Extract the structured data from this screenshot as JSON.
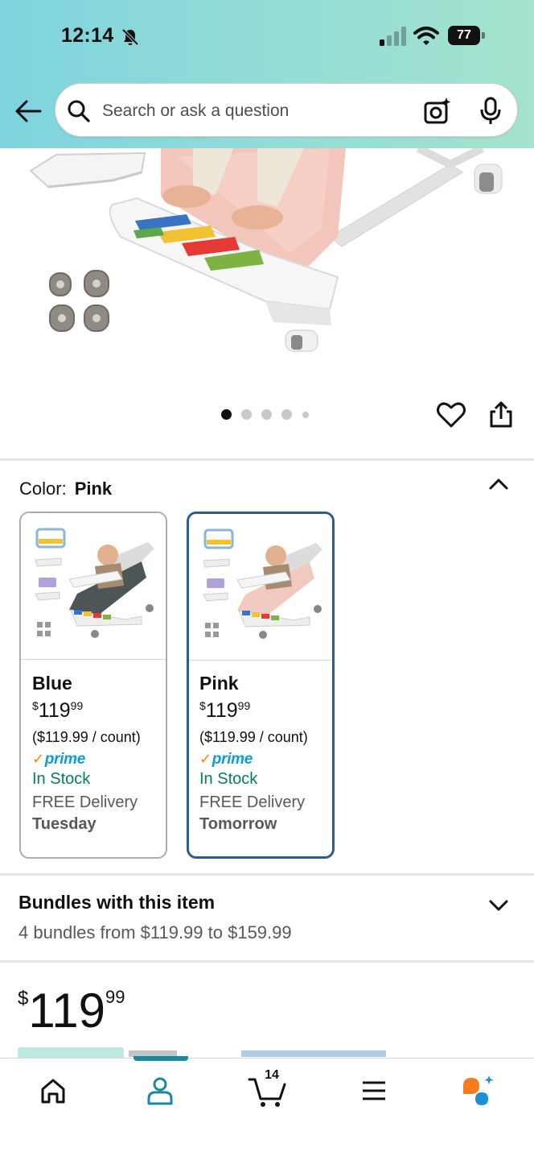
{
  "status_bar": {
    "time": "12:14",
    "battery": "77"
  },
  "search": {
    "placeholder": "Search or ask a question"
  },
  "gallery": {
    "image_count": 5,
    "active_index": 0
  },
  "color_selector": {
    "label": "Color:",
    "selected": "Pink",
    "options": [
      {
        "name": "Blue",
        "price_currency": "$",
        "price_whole": "119",
        "price_fraction": "99",
        "unit_price": "($119.99 / count)",
        "prime": "prime",
        "stock": "In Stock",
        "delivery": "FREE Delivery",
        "delivery_day": "Tuesday",
        "seat_color": "#4e5557"
      },
      {
        "name": "Pink",
        "price_currency": "$",
        "price_whole": "119",
        "price_fraction": "99",
        "unit_price": "($119.99 / count)",
        "prime": "prime",
        "stock": "In Stock",
        "delivery": "FREE Delivery",
        "delivery_day": "Tomorrow",
        "seat_color": "#f0c9c0"
      }
    ]
  },
  "bundles": {
    "title": "Bundles with this item",
    "subtitle": "4 bundles from $119.99 to $159.99"
  },
  "price": {
    "currency": "$",
    "whole": "119",
    "fraction": "99"
  },
  "bottom_nav": {
    "cart_count": "14",
    "active": "account"
  },
  "colors": {
    "header_start": "#7fd3de",
    "header_end": "#a4e3cd",
    "selected_border": "#2b5d8f",
    "prime_blue": "#1399d6",
    "stock_green": "#067d62",
    "nav_active": "#178aa0",
    "rufus_orange": "#f57c1f",
    "rufus_blue": "#1f8fd6"
  }
}
